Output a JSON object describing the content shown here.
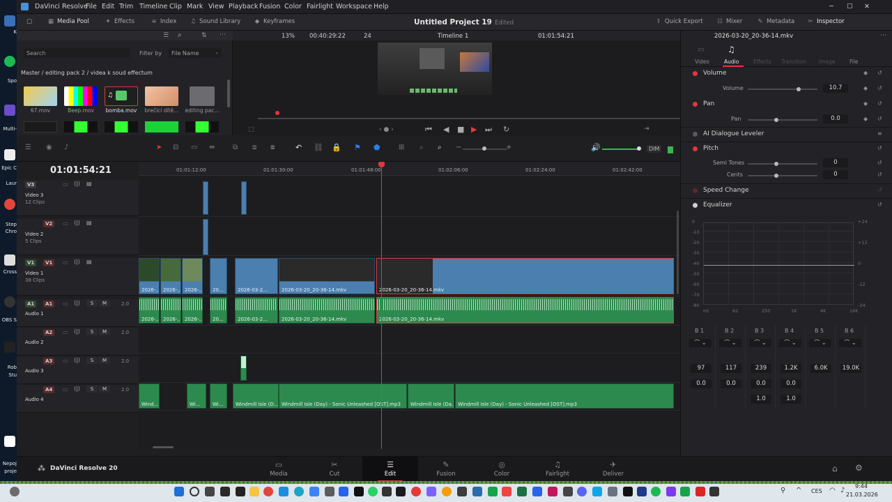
{
  "desktop": {
    "icons": [
      "K",
      "Spo",
      "Multi-",
      "Epic C",
      "Laur",
      "Step",
      "Chro",
      "Cross",
      "OBS S",
      "Rob",
      "Stu",
      "Nepoj",
      "proje"
    ]
  },
  "app": {
    "title": "DaVinci Resolve",
    "menu": [
      "File",
      "Edit",
      "Trim",
      "Timeline",
      "Clip",
      "Mark",
      "View",
      "Playback",
      "Fusion",
      "Color",
      "Fairlight",
      "Workspace",
      "Help"
    ],
    "project_title": "Untitled Project 19",
    "edited": "Edited"
  },
  "toolbar": {
    "media_pool": "Media Pool",
    "effects": "Effects",
    "index": "Index",
    "sound_library": "Sound Library",
    "keyframes": "Keyframes",
    "quick_export": "Quick Export",
    "mixer": "Mixer",
    "metadata": "Metadata",
    "inspector": "Inspector"
  },
  "media_pool": {
    "search_placeholder": "Search",
    "filter_by": "Filter by",
    "filter_value": "File Name",
    "breadcrumb": "Master / editing pack 2 / videa k soud effectum",
    "items": [
      {
        "name": "67.mov"
      },
      {
        "name": "Beep.mov"
      },
      {
        "name": "bomba.mov"
      },
      {
        "name": "brečící dítě..."
      },
      {
        "name": "editing pac..."
      }
    ]
  },
  "viewer": {
    "zoom": "13%",
    "source_tc": "00:40:29:22",
    "fps": "24",
    "timeline_name": "Timeline 1",
    "record_tc": "01:01:54:21"
  },
  "inspector": {
    "clip_name": "2026-03-20_20-36-14.mkv",
    "tabs": [
      "Video",
      "Audio",
      "Effects",
      "Transition",
      "Image",
      "File"
    ],
    "active_tab": "Audio",
    "volume_header": "Volume",
    "volume_label": "Volume",
    "volume_value": "10.7",
    "pan_header": "Pan",
    "pan_label": "Pan",
    "pan_value": "0.0",
    "dialogue_leveler": "AI Dialogue Leveler",
    "pitch_header": "Pitch",
    "semi_tones_label": "Semi Tones",
    "semi_tones_value": "0",
    "cents_label": "Cents",
    "cents_value": "0",
    "speed_change": "Speed Change",
    "equalizer": "Equalizer",
    "eq_left_scale": [
      "0",
      "-10",
      "-20",
      "-30",
      "-40",
      "-50",
      "-60",
      "-70",
      "-80"
    ],
    "eq_right_scale": [
      "+24",
      "+12",
      "0",
      "-12",
      "-24"
    ],
    "eq_freq": [
      "Hz",
      "62",
      "250",
      "1K",
      "4K",
      "16K"
    ],
    "bands": [
      "B 1",
      "B 2",
      "B 3",
      "B 4",
      "B 5",
      "B 6"
    ],
    "freqs": [
      "97",
      "117",
      "239",
      "1.2K",
      "6.0K",
      "19.0K"
    ],
    "gains": [
      "0.0",
      "0.0",
      "0.0",
      "0.0"
    ],
    "qs": [
      "1.0",
      "1.0"
    ]
  },
  "timeline": {
    "timecode": "01:01:54:21",
    "dim": "DIM",
    "ruler": [
      "01:01:12:00",
      "01:01:30:00",
      "01:01:48:00",
      "01:02:06:00",
      "01:02:24:00",
      "01:02:42:00"
    ],
    "tracks": {
      "v3": {
        "tag": "V3",
        "name": "Video 3",
        "clips": "12 Clips"
      },
      "v2": {
        "tag": "V2",
        "name": "Video 2",
        "clips": "5 Clips"
      },
      "v1": {
        "tag": "V1",
        "name": "Video 1",
        "clips": "38 Clips"
      },
      "a1": {
        "tag": "A1",
        "name": "Audio 1",
        "level": "2.0"
      },
      "a2": {
        "tag": "A2",
        "name": "Audio 2",
        "level": "2.0"
      },
      "a3": {
        "tag": "A3",
        "name": "Audio 3",
        "level": "2.0"
      },
      "a4": {
        "tag": "A4",
        "name": "Audio 4",
        "level": "2.0"
      }
    },
    "v1_clips": [
      "2026-...",
      "2026-...",
      "2026-...",
      "20...",
      "2026-03-2...",
      "2026-03-20_20-36-14.mkv",
      "2026-03-20_20-36-14.mkv"
    ],
    "a1_clips": [
      "2026-...",
      "2026-...",
      "2026-...",
      "20...",
      "2026-03-2...",
      "2026-03-20_20-36-14.mkv",
      "2026-03-20_20-36-14.mkv"
    ],
    "a4_clips": [
      "Wind...",
      "Wi...",
      "Wi...",
      "Windmill Isle (D...",
      "Windmill Isle (Day) - Sonic Unleashed [OST].mp3",
      "Windmill Isle (Da...",
      "Windmill Isle (Day) - Sonic Unleashed [OST].mp3"
    ]
  },
  "pages": {
    "brand": "DaVinci Resolve 20",
    "items": [
      "Media",
      "Cut",
      "Edit",
      "Fusion",
      "Color",
      "Fairlight",
      "Deliver"
    ],
    "active": "Edit"
  },
  "taskbar": {
    "lang": "CES",
    "time": "9:44",
    "date": "21.03.2026"
  },
  "colors": {
    "accent_red": "#e0383d",
    "clip_blue": "#4a7fb0",
    "clip_green": "#2d8a4e"
  }
}
